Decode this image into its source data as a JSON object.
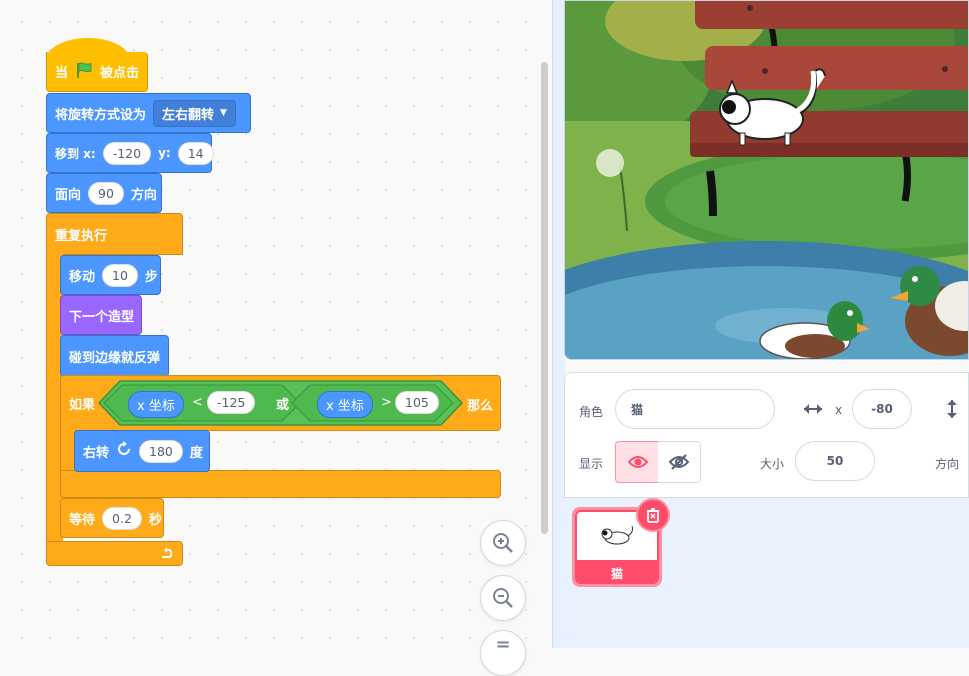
{
  "scripts": {
    "when_flag": {
      "when": "当",
      "clicked": "被点击"
    },
    "rotation": {
      "label": "将旋转方式设为",
      "value": "左右翻转"
    },
    "goto": {
      "label": "移到 x:",
      "x": "-120",
      "ylabel": "y:",
      "y": "14"
    },
    "point": {
      "label": "面向",
      "value": "90",
      "suffix": "方向"
    },
    "forever": {
      "label": "重复执行"
    },
    "move": {
      "label": "移动",
      "value": "10",
      "suffix": "步"
    },
    "next_costume": {
      "label": "下一个造型"
    },
    "bounce": {
      "label": "碰到边缘就反弹"
    },
    "if_block": {
      "if": "如果",
      "xpos1": "x 坐标",
      "lt": "<",
      "v1": "-125",
      "or": "或",
      "xpos2": "x 坐标",
      "gt": ">",
      "v2": "105",
      "then": "那么"
    },
    "turn": {
      "label": "右转",
      "value": "180",
      "suffix": "度"
    },
    "wait": {
      "label": "等待",
      "value": "0.2",
      "suffix": "秒"
    }
  },
  "sprite_info": {
    "sprite_label": "角色",
    "sprite_name": "猫",
    "x_label": "x",
    "x_value": "-80",
    "show_label": "显示",
    "size_label": "大小",
    "size_value": "50",
    "direction_label": "方向"
  },
  "sprite_list": [
    {
      "name": "猫",
      "selected": true
    }
  ],
  "colors": {
    "events": "#ffbf00",
    "motion": "#4c97ff",
    "control": "#ffab19",
    "operators": "#59c059",
    "looks": "#9966ff",
    "accent": "#ff6680"
  }
}
